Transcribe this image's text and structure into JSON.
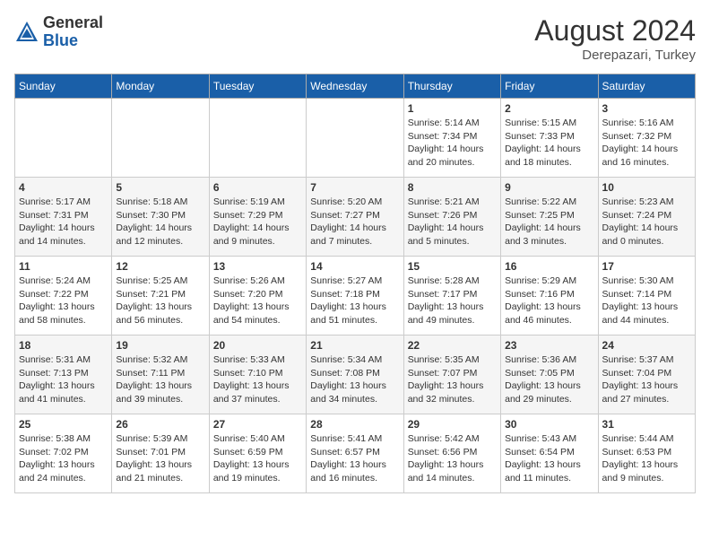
{
  "header": {
    "logo_general": "General",
    "logo_blue": "Blue",
    "month_year": "August 2024",
    "location": "Derepazari, Turkey"
  },
  "days_of_week": [
    "Sunday",
    "Monday",
    "Tuesday",
    "Wednesday",
    "Thursday",
    "Friday",
    "Saturday"
  ],
  "weeks": [
    [
      {
        "day": "",
        "info": ""
      },
      {
        "day": "",
        "info": ""
      },
      {
        "day": "",
        "info": ""
      },
      {
        "day": "",
        "info": ""
      },
      {
        "day": "1",
        "info": "Sunrise: 5:14 AM\nSunset: 7:34 PM\nDaylight: 14 hours\nand 20 minutes."
      },
      {
        "day": "2",
        "info": "Sunrise: 5:15 AM\nSunset: 7:33 PM\nDaylight: 14 hours\nand 18 minutes."
      },
      {
        "day": "3",
        "info": "Sunrise: 5:16 AM\nSunset: 7:32 PM\nDaylight: 14 hours\nand 16 minutes."
      }
    ],
    [
      {
        "day": "4",
        "info": "Sunrise: 5:17 AM\nSunset: 7:31 PM\nDaylight: 14 hours\nand 14 minutes."
      },
      {
        "day": "5",
        "info": "Sunrise: 5:18 AM\nSunset: 7:30 PM\nDaylight: 14 hours\nand 12 minutes."
      },
      {
        "day": "6",
        "info": "Sunrise: 5:19 AM\nSunset: 7:29 PM\nDaylight: 14 hours\nand 9 minutes."
      },
      {
        "day": "7",
        "info": "Sunrise: 5:20 AM\nSunset: 7:27 PM\nDaylight: 14 hours\nand 7 minutes."
      },
      {
        "day": "8",
        "info": "Sunrise: 5:21 AM\nSunset: 7:26 PM\nDaylight: 14 hours\nand 5 minutes."
      },
      {
        "day": "9",
        "info": "Sunrise: 5:22 AM\nSunset: 7:25 PM\nDaylight: 14 hours\nand 3 minutes."
      },
      {
        "day": "10",
        "info": "Sunrise: 5:23 AM\nSunset: 7:24 PM\nDaylight: 14 hours\nand 0 minutes."
      }
    ],
    [
      {
        "day": "11",
        "info": "Sunrise: 5:24 AM\nSunset: 7:22 PM\nDaylight: 13 hours\nand 58 minutes."
      },
      {
        "day": "12",
        "info": "Sunrise: 5:25 AM\nSunset: 7:21 PM\nDaylight: 13 hours\nand 56 minutes."
      },
      {
        "day": "13",
        "info": "Sunrise: 5:26 AM\nSunset: 7:20 PM\nDaylight: 13 hours\nand 54 minutes."
      },
      {
        "day": "14",
        "info": "Sunrise: 5:27 AM\nSunset: 7:18 PM\nDaylight: 13 hours\nand 51 minutes."
      },
      {
        "day": "15",
        "info": "Sunrise: 5:28 AM\nSunset: 7:17 PM\nDaylight: 13 hours\nand 49 minutes."
      },
      {
        "day": "16",
        "info": "Sunrise: 5:29 AM\nSunset: 7:16 PM\nDaylight: 13 hours\nand 46 minutes."
      },
      {
        "day": "17",
        "info": "Sunrise: 5:30 AM\nSunset: 7:14 PM\nDaylight: 13 hours\nand 44 minutes."
      }
    ],
    [
      {
        "day": "18",
        "info": "Sunrise: 5:31 AM\nSunset: 7:13 PM\nDaylight: 13 hours\nand 41 minutes."
      },
      {
        "day": "19",
        "info": "Sunrise: 5:32 AM\nSunset: 7:11 PM\nDaylight: 13 hours\nand 39 minutes."
      },
      {
        "day": "20",
        "info": "Sunrise: 5:33 AM\nSunset: 7:10 PM\nDaylight: 13 hours\nand 37 minutes."
      },
      {
        "day": "21",
        "info": "Sunrise: 5:34 AM\nSunset: 7:08 PM\nDaylight: 13 hours\nand 34 minutes."
      },
      {
        "day": "22",
        "info": "Sunrise: 5:35 AM\nSunset: 7:07 PM\nDaylight: 13 hours\nand 32 minutes."
      },
      {
        "day": "23",
        "info": "Sunrise: 5:36 AM\nSunset: 7:05 PM\nDaylight: 13 hours\nand 29 minutes."
      },
      {
        "day": "24",
        "info": "Sunrise: 5:37 AM\nSunset: 7:04 PM\nDaylight: 13 hours\nand 27 minutes."
      }
    ],
    [
      {
        "day": "25",
        "info": "Sunrise: 5:38 AM\nSunset: 7:02 PM\nDaylight: 13 hours\nand 24 minutes."
      },
      {
        "day": "26",
        "info": "Sunrise: 5:39 AM\nSunset: 7:01 PM\nDaylight: 13 hours\nand 21 minutes."
      },
      {
        "day": "27",
        "info": "Sunrise: 5:40 AM\nSunset: 6:59 PM\nDaylight: 13 hours\nand 19 minutes."
      },
      {
        "day": "28",
        "info": "Sunrise: 5:41 AM\nSunset: 6:57 PM\nDaylight: 13 hours\nand 16 minutes."
      },
      {
        "day": "29",
        "info": "Sunrise: 5:42 AM\nSunset: 6:56 PM\nDaylight: 13 hours\nand 14 minutes."
      },
      {
        "day": "30",
        "info": "Sunrise: 5:43 AM\nSunset: 6:54 PM\nDaylight: 13 hours\nand 11 minutes."
      },
      {
        "day": "31",
        "info": "Sunrise: 5:44 AM\nSunset: 6:53 PM\nDaylight: 13 hours\nand 9 minutes."
      }
    ]
  ]
}
